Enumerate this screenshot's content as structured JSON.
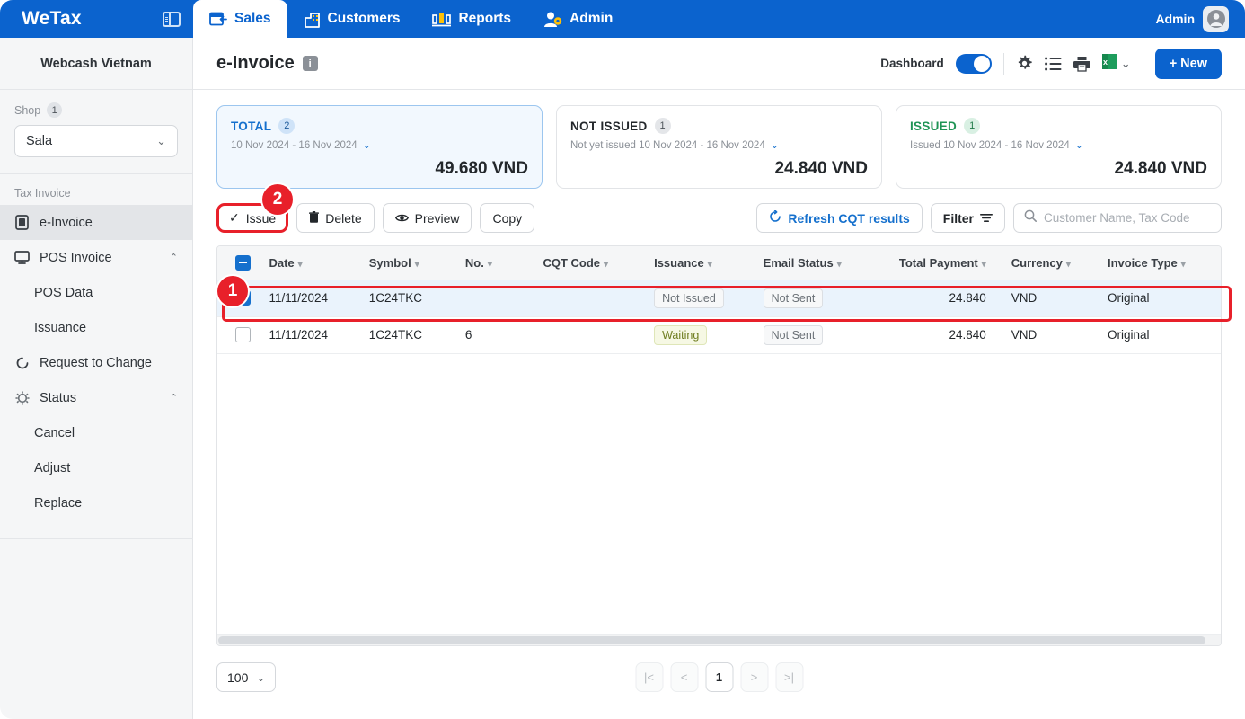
{
  "topbar": {
    "brand": "WeTax",
    "panel_toggle_icon": "panel-layout-icon",
    "tabs": [
      {
        "label": "Sales",
        "icon": "sales-card-icon",
        "active": true
      },
      {
        "label": "Customers",
        "icon": "building-icon",
        "active": false
      },
      {
        "label": "Reports",
        "icon": "bar-chart-icon",
        "active": false
      },
      {
        "label": "Admin",
        "icon": "user-gear-icon",
        "active": false
      }
    ],
    "user_label": "Admin",
    "avatar_icon": "user-avatar-icon"
  },
  "sidebar": {
    "company": "Webcash Vietnam",
    "shop_label": "Shop",
    "shop_count": "1",
    "shop_value": "Sala",
    "section_label": "Tax Invoice",
    "items": [
      {
        "label": "e-Invoice",
        "icon": "invoice-icon",
        "active": true,
        "expandable": false
      },
      {
        "label": "POS Invoice",
        "icon": "monitor-icon",
        "active": false,
        "expandable": true
      },
      {
        "label": "POS Data",
        "sub": true
      },
      {
        "label": "Issuance",
        "sub": true
      },
      {
        "label": "Request to Change",
        "icon": "refresh-circle-icon",
        "active": false,
        "expandable": false
      },
      {
        "label": "Status",
        "icon": "gear-dotted-icon",
        "active": false,
        "expandable": true
      },
      {
        "label": "Cancel",
        "sub": true
      },
      {
        "label": "Adjust",
        "sub": true
      },
      {
        "label": "Replace",
        "sub": true
      }
    ]
  },
  "page": {
    "title": "e-Invoice",
    "info_badge": "i",
    "dashboard_label": "Dashboard",
    "dashboard_on": true,
    "icons": [
      "gear-icon",
      "list-icon",
      "printer-icon",
      "excel-icon",
      "chevron-down-icon"
    ],
    "new_button": "+ New"
  },
  "cards": [
    {
      "title": "TOTAL",
      "count": "2",
      "range": "10 Nov 2024 - 16 Nov 2024",
      "amount": "49.680 VND",
      "accent": "#1570cd",
      "highlighted": true
    },
    {
      "title": "NOT ISSUED",
      "count": "1",
      "range": "Not yet issued 10 Nov 2024 - 16 Nov 2024",
      "amount": "24.840 VND",
      "accent": "#23272b",
      "highlighted": false
    },
    {
      "title": "ISSUED",
      "count": "1",
      "range": "Issued 10 Nov 2024 - 16 Nov 2024",
      "amount": "24.840 VND",
      "accent": "#1f9455",
      "highlighted": false
    }
  ],
  "toolbar": {
    "issue": "Issue",
    "delete": "Delete",
    "preview": "Preview",
    "copy": "Copy",
    "refresh": "Refresh CQT results",
    "filter": "Filter",
    "search_placeholder": "Customer Name, Tax Code",
    "search_value": ""
  },
  "table": {
    "columns": [
      "Date",
      "Symbol",
      "No.",
      "CQT Code",
      "Issuance",
      "Email Status",
      "Total Payment",
      "Currency",
      "Invoice Type"
    ],
    "header_checkbox_state": "indeterminate",
    "rows": [
      {
        "checked": true,
        "selected": true,
        "date": "11/11/2024",
        "symbol": "1C24TKC",
        "no": "",
        "cqt_code": "",
        "issuance": "Not Issued",
        "issuance_style": "default",
        "email_status": "Not Sent",
        "total_payment": "24.840",
        "currency": "VND",
        "invoice_type": "Original"
      },
      {
        "checked": false,
        "selected": false,
        "date": "11/11/2024",
        "symbol": "1C24TKC",
        "no": "6",
        "cqt_code": "",
        "issuance": "Waiting",
        "issuance_style": "waiting",
        "email_status": "Not Sent",
        "total_payment": "24.840",
        "currency": "VND",
        "invoice_type": "Original"
      }
    ]
  },
  "footer": {
    "page_size": "100",
    "first_icon": "|<",
    "prev_icon": "<",
    "current_page": "1",
    "next_icon": ">",
    "last_icon": ">|"
  },
  "annotations": {
    "badge_1": "1",
    "badge_2": "2",
    "highlight_color": "#e8202a"
  }
}
